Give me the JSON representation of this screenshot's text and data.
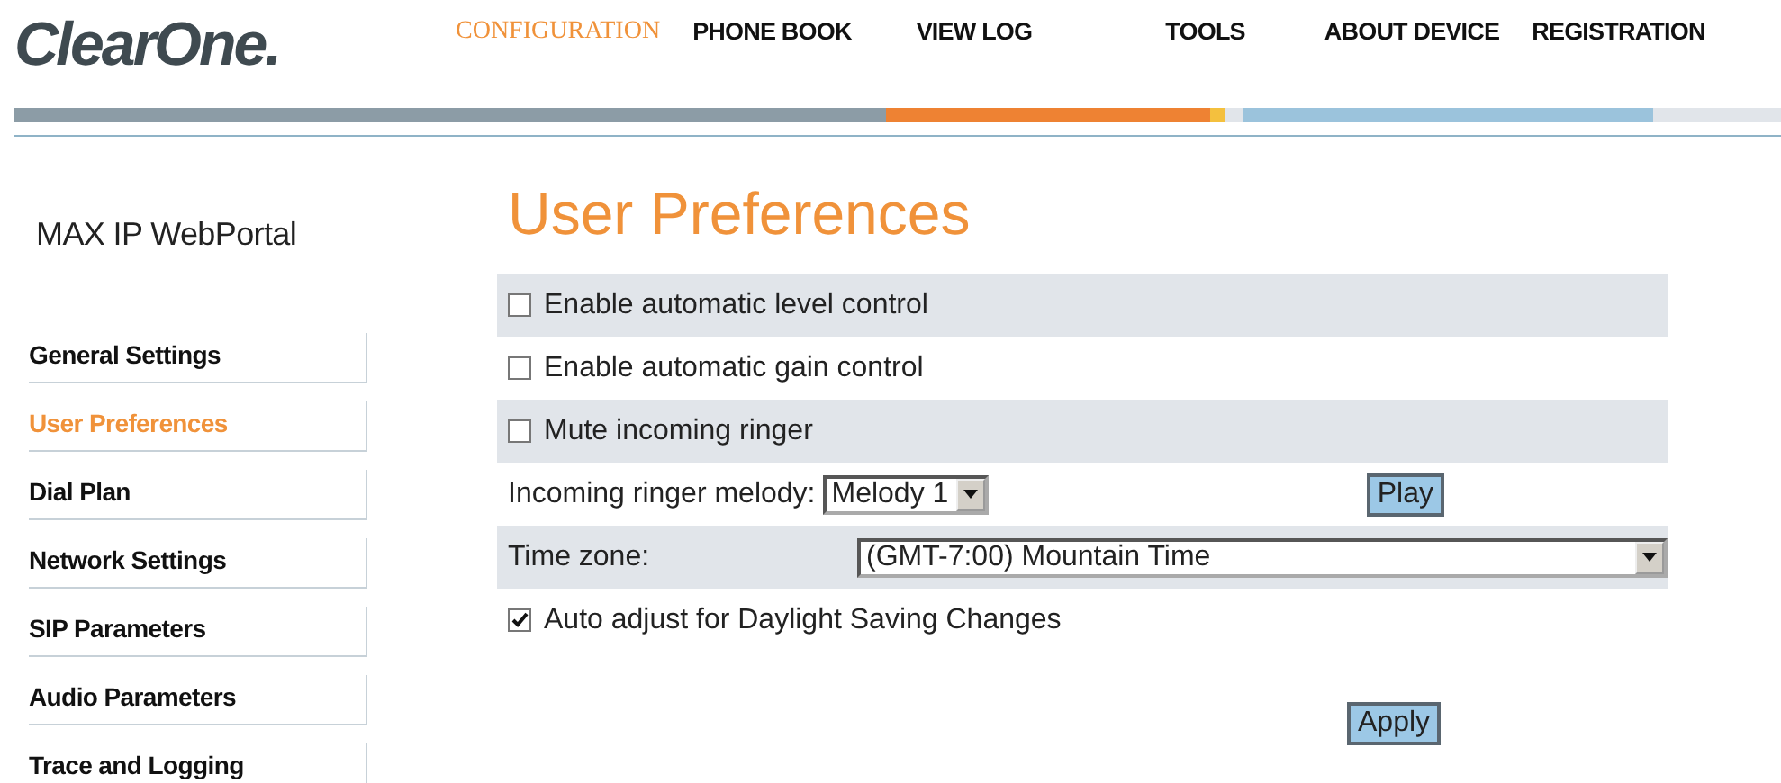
{
  "logo": "ClearOne.",
  "nav": [
    {
      "label": "CONFIGURATION",
      "selected": true
    },
    {
      "label": "PHONE BOOK",
      "selected": false
    },
    {
      "label": "VIEW LOG",
      "selected": false
    },
    {
      "label": "TOOLS",
      "selected": false
    },
    {
      "label": "ABOUT DEVICE",
      "selected": false
    },
    {
      "label": "REGISTRATION",
      "selected": false
    }
  ],
  "sidebar": {
    "title": "MAX IP WebPortal",
    "items": [
      {
        "label": "General Settings",
        "selected": false
      },
      {
        "label": "User Preferences",
        "selected": true
      },
      {
        "label": "Dial Plan",
        "selected": false
      },
      {
        "label": "Network Settings",
        "selected": false
      },
      {
        "label": "SIP Parameters",
        "selected": false
      },
      {
        "label": "Audio Parameters",
        "selected": false
      },
      {
        "label": "Trace and Logging",
        "selected": false
      }
    ]
  },
  "page_title": "User Preferences",
  "rows": [
    {
      "kind": "checkbox",
      "label": "Enable automatic level control",
      "checked": false
    },
    {
      "kind": "checkbox",
      "label": "Enable automatic gain control",
      "checked": false
    },
    {
      "kind": "checkbox",
      "label": "Mute incoming ringer",
      "checked": false
    },
    {
      "kind": "select",
      "label": "Incoming ringer melody:",
      "value": "Melody 1",
      "button": "Play"
    },
    {
      "kind": "wide-select",
      "label": "Time zone:",
      "value": "(GMT-7:00) Mountain Time"
    },
    {
      "kind": "checkbox",
      "label": "Auto adjust for Daylight Saving Changes",
      "checked": true
    }
  ],
  "apply_button": "Apply"
}
